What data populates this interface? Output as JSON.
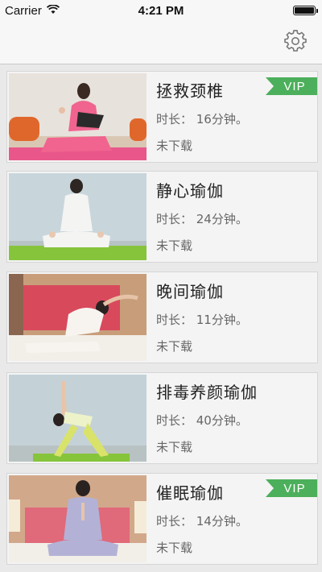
{
  "status_bar": {
    "carrier": "Carrier",
    "time": "4:21 PM"
  },
  "nav": {
    "settings_icon": "gear-icon"
  },
  "items": [
    {
      "title": "拯救颈椎",
      "duration": "时长：  16分钟。",
      "status": "未下载",
      "vip": "VIP"
    },
    {
      "title": "静心瑜伽",
      "duration": "时长：  24分钟。",
      "status": "未下载"
    },
    {
      "title": "晚间瑜伽",
      "duration": "时长：  11分钟。",
      "status": "未下载"
    },
    {
      "title": "排毒养颜瑜伽",
      "duration": "时长：  40分钟。",
      "status": "未下载"
    },
    {
      "title": "催眠瑜伽",
      "duration": "时长：  14分钟。",
      "status": "未下载",
      "vip": "VIP"
    }
  ],
  "colors": {
    "vip_badge": "#4caf5b",
    "background": "#e9e9e9"
  }
}
